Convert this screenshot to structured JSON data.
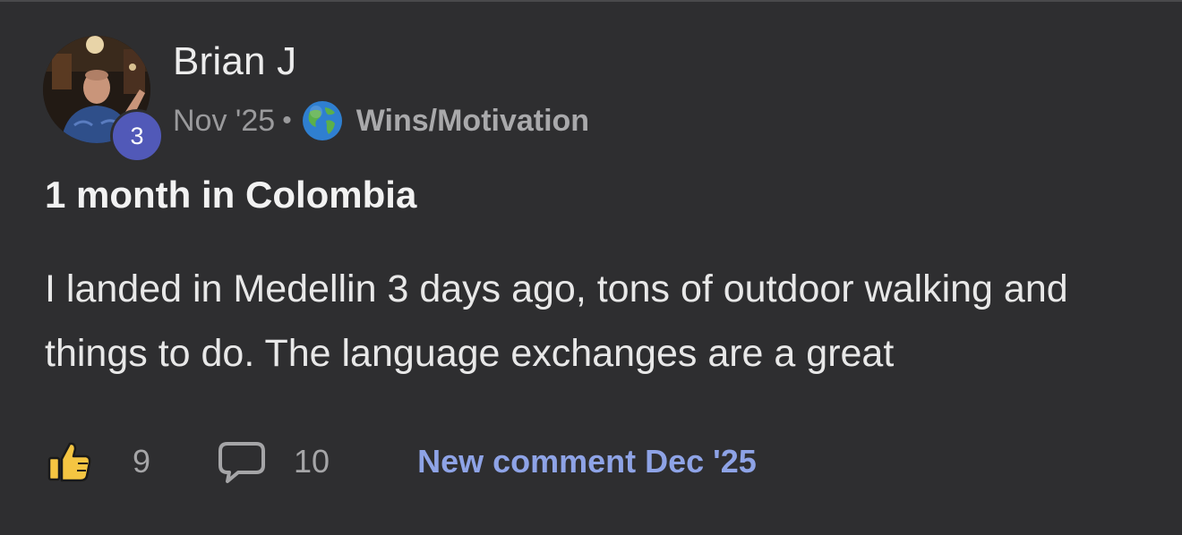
{
  "post": {
    "author": "Brian J",
    "author_level": "3",
    "date": "Nov '25",
    "separator": "•",
    "category_icon": "globe-icon",
    "category": "Wins/Motivation",
    "title": "1 month in Colombia",
    "body": "I landed in Medellin 3 days ago, tons of outdoor walking and things to do. The language exchanges are a great"
  },
  "actions": {
    "like_icon": "thumbs-up-icon",
    "like_count": "9",
    "comment_icon": "comment-bubble-icon",
    "comment_count": "10",
    "new_comment_label": "New comment Dec '25"
  },
  "colors": {
    "background": "#2e2e30",
    "level_badge": "#5159b8",
    "link_accent": "#8ea3e6"
  }
}
